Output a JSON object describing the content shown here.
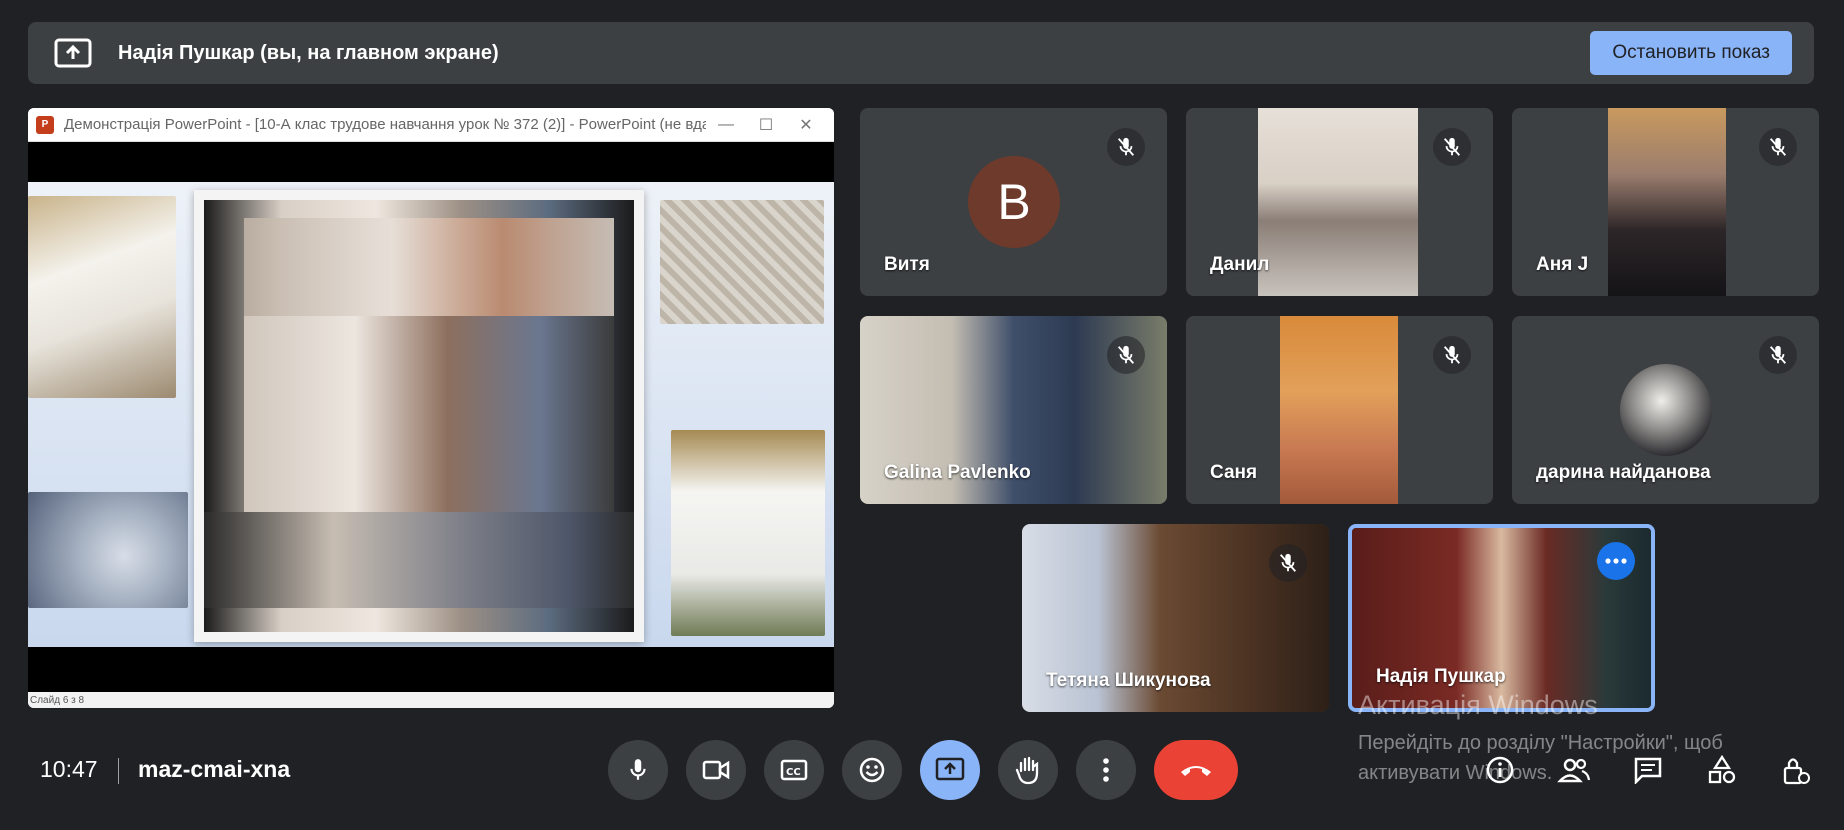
{
  "banner": {
    "title": "Надія Пушкар (вы, на главном экране)",
    "stop_label": "Остановить показ"
  },
  "presentation": {
    "window_title": "Демонстрація PowerPoint - [10-А клас трудове навчання урок № 372 (2)] - PowerPoint (не вда...",
    "app_logo": "P",
    "status": "Слайд 6 з 8"
  },
  "participants": [
    {
      "name": "Витя",
      "avatar_letter": "В",
      "avatar_color": "#6d3a2c",
      "muted": true
    },
    {
      "name": "Данил",
      "muted": true
    },
    {
      "name": "Аня J",
      "muted": true
    },
    {
      "name": "Galina Pavlenko",
      "muted": true
    },
    {
      "name": "Саня",
      "muted": true
    },
    {
      "name": "дарина найданова",
      "muted": true
    },
    {
      "name": "Тетяна Шикунова",
      "muted": true
    },
    {
      "name": "Надія Пушкар",
      "muted": false,
      "active_speaker": true
    }
  ],
  "watermark": {
    "title": "Активація Windows",
    "line1": "Перейдіть до розділу \"Настройки\", щоб",
    "line2": "активувати Windows."
  },
  "meeting": {
    "time": "10:47",
    "code": "maz-cmai-xna"
  },
  "colors": {
    "background": "#202124",
    "tile": "#3c4043",
    "accent": "#8ab4f8",
    "end_call": "#ea4335"
  },
  "controls": [
    "mic-icon",
    "camera-icon",
    "captions-icon",
    "emoji-icon",
    "present-icon",
    "raise-hand-icon",
    "more-vert-icon",
    "end-call-icon"
  ],
  "side_controls": [
    "info-icon",
    "people-icon",
    "chat-icon",
    "activities-icon",
    "host-controls-icon"
  ]
}
